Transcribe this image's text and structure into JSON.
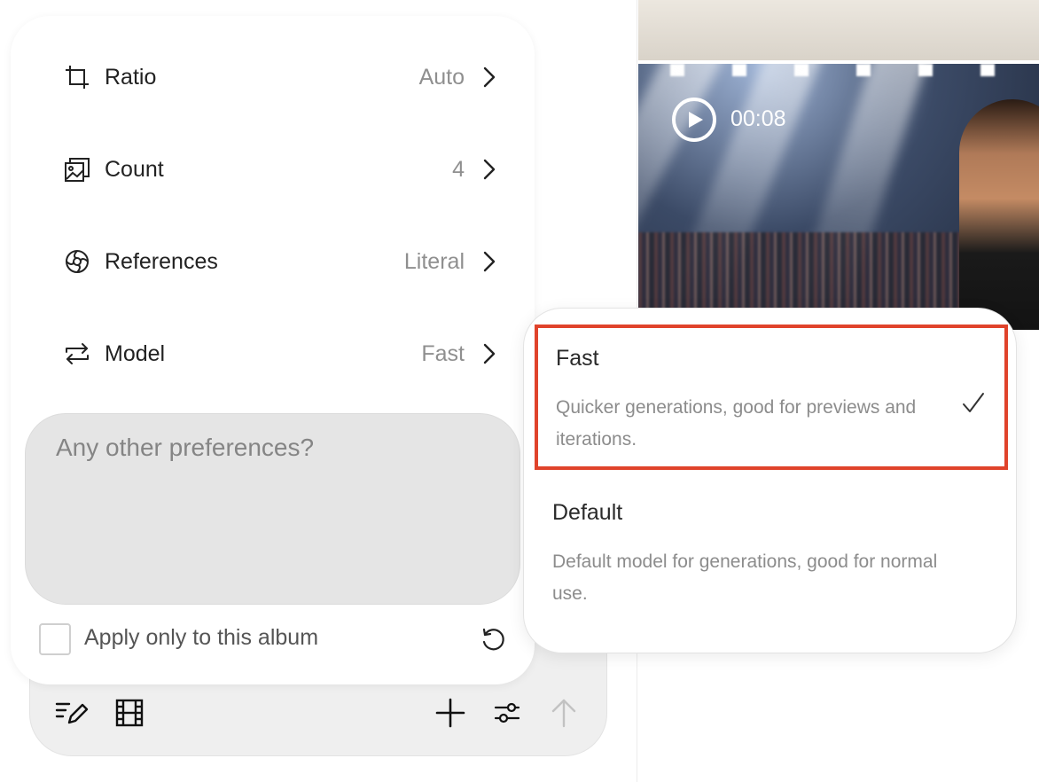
{
  "settings": {
    "rows": [
      {
        "label": "Ratio",
        "value": "Auto",
        "icon": "crop-icon"
      },
      {
        "label": "Count",
        "value": "4",
        "icon": "image-stack-icon"
      },
      {
        "label": "References",
        "value": "Literal",
        "icon": "references-icon"
      },
      {
        "label": "Model",
        "value": "Fast",
        "icon": "swap-icon"
      }
    ],
    "preferences_placeholder": "Any other preferences?",
    "apply_label": "Apply only to this album",
    "apply_checked": false
  },
  "media": {
    "video_duration": "00:08"
  },
  "model_menu": {
    "options": [
      {
        "title": "Fast",
        "description": "Quicker generations, good for previews and iterations.",
        "selected": true
      },
      {
        "title": "Default",
        "description": "Default model for generations, good for normal use.",
        "selected": false
      }
    ],
    "highlight_color": "#e0432b"
  },
  "toolbar": {
    "icons": [
      "edit-list-icon",
      "film-icon",
      "plus-icon",
      "sliders-icon",
      "arrow-up-icon"
    ]
  }
}
